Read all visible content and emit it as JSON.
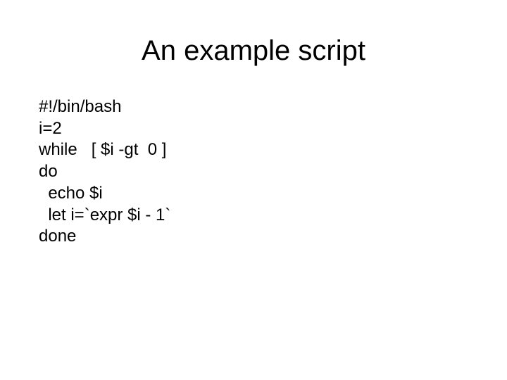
{
  "title": "An example script",
  "code": "#!/bin/bash\ni=2\nwhile   [ $i -gt  0 ]\ndo\n  echo $i\n  let i=`expr $i - 1`\ndone"
}
